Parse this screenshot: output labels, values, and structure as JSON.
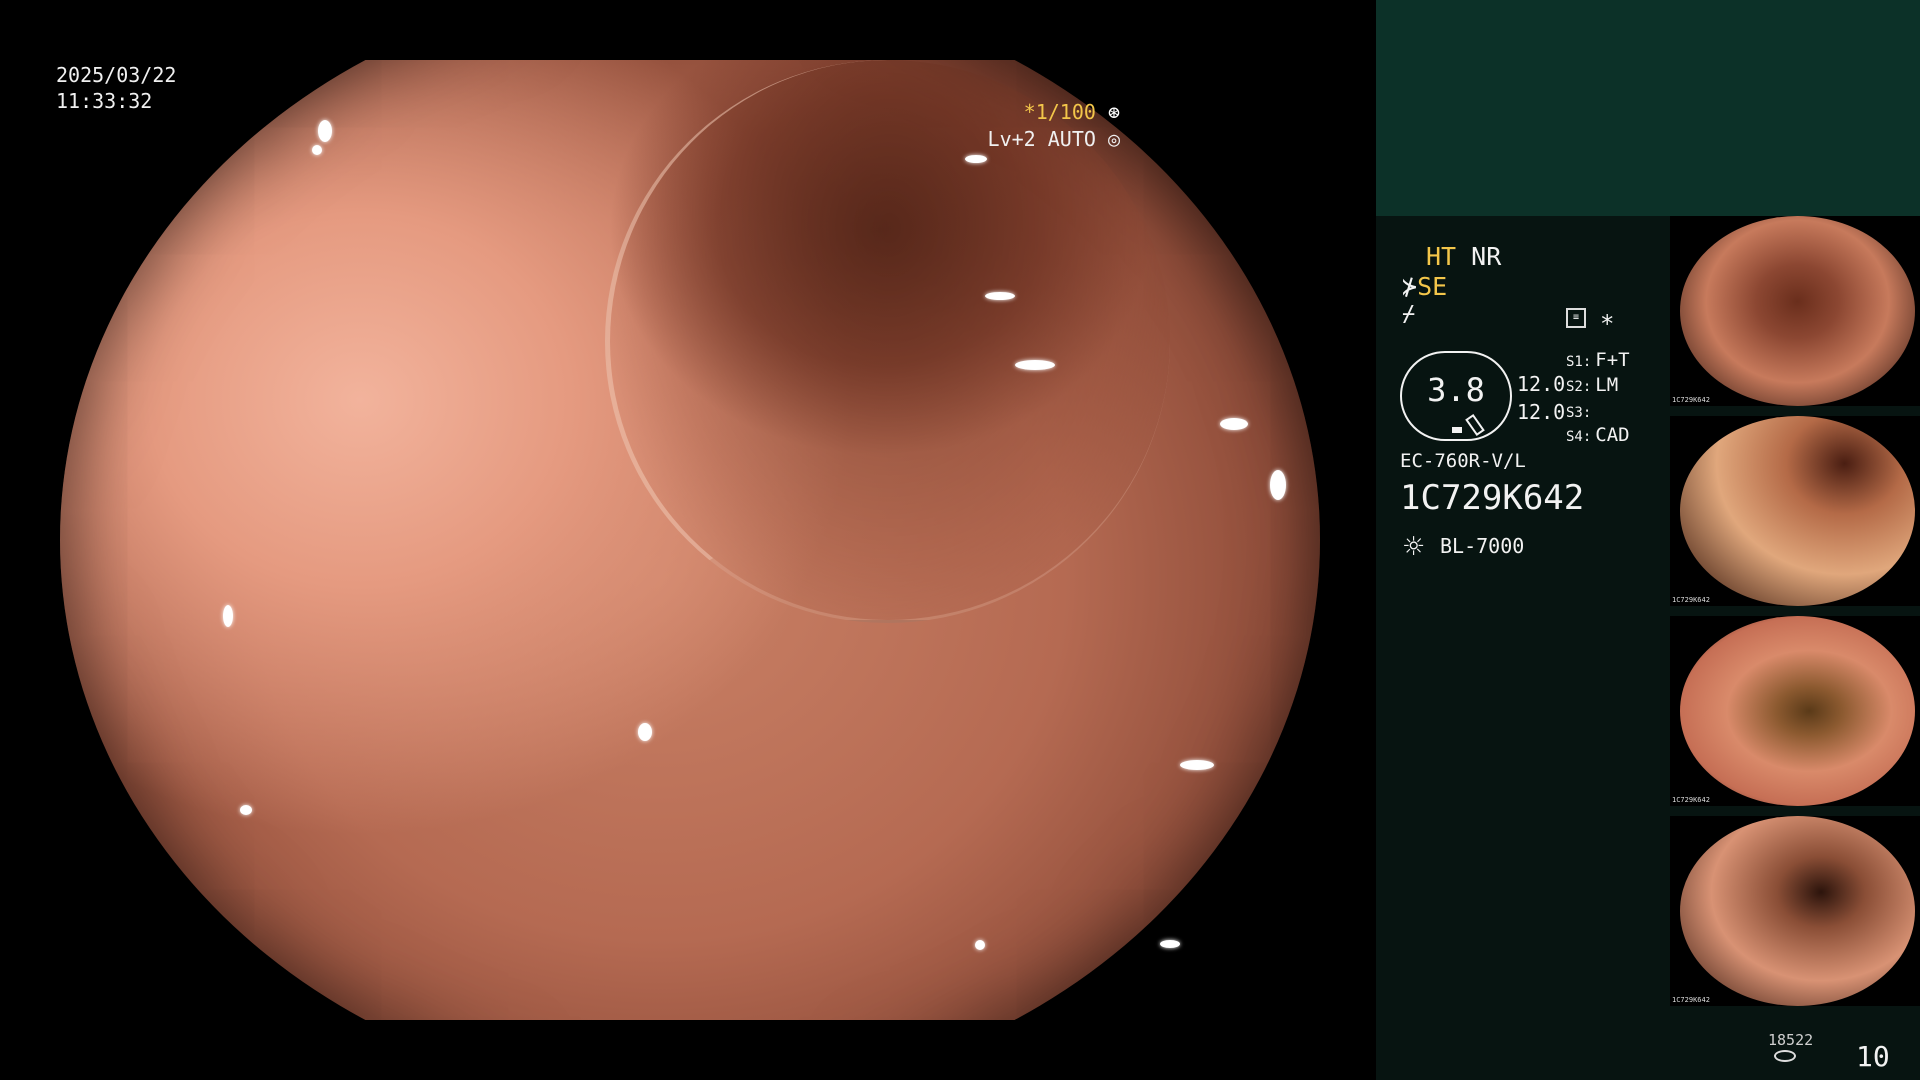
{
  "overlay": {
    "date": "2025/03/22",
    "time": "11:33:32",
    "shutter": "*1/100",
    "level": "Lv+2 AUTO"
  },
  "panel": {
    "ht": "HT",
    "nr": "NR",
    "se": "SE",
    "gauge": "3.8",
    "gauge_v1": "12.0",
    "gauge_v2": "12.0",
    "s1": "F+T",
    "s2": "LM",
    "s3": "",
    "s4": "CAD",
    "model": "EC-760R-V/L",
    "serial": "1C729K642",
    "lamp": "BL-7000",
    "count_small": "18522",
    "count_big": "10"
  },
  "thumbnails": [
    {
      "tag": "1C729K642"
    },
    {
      "tag": "1C729K642"
    },
    {
      "tag": "1C729K642"
    },
    {
      "tag": "1C729K642"
    }
  ],
  "colors": {
    "accent_yellow": "#f3c64a",
    "panel_top": "#0c3128",
    "panel_bg": "#071411"
  }
}
